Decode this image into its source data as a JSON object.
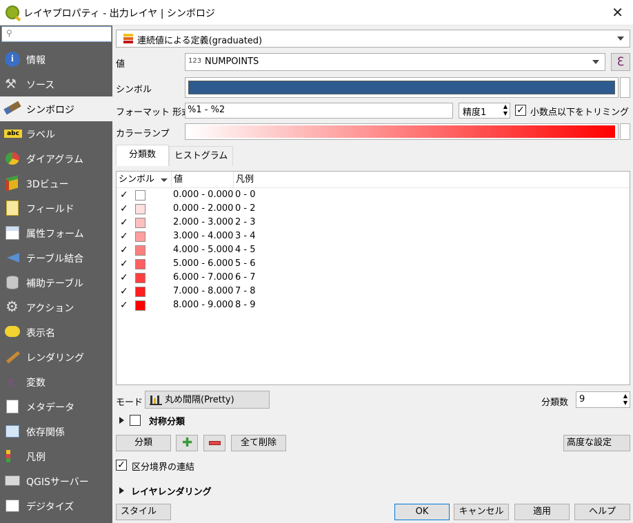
{
  "window": {
    "title": "レイヤプロパティ - 出力レイヤ | シンボロジ"
  },
  "sidebar": {
    "search_placeholder": "",
    "items": [
      {
        "label": "情報",
        "icon": "info-icon"
      },
      {
        "label": "ソース",
        "icon": "wrench-icon"
      },
      {
        "label": "シンボロジ",
        "icon": "paintbrush-icon"
      },
      {
        "label": "ラベル",
        "icon": "abc-label-icon"
      },
      {
        "label": "ダイアグラム",
        "icon": "diagram-icon"
      },
      {
        "label": "3Dビュー",
        "icon": "cube-icon"
      },
      {
        "label": "フィールド",
        "icon": "fields-icon"
      },
      {
        "label": "属性フォーム",
        "icon": "form-icon"
      },
      {
        "label": "テーブル結合",
        "icon": "join-icon"
      },
      {
        "label": "補助テーブル",
        "icon": "database-icon"
      },
      {
        "label": "アクション",
        "icon": "action-gear-icon"
      },
      {
        "label": "表示名",
        "icon": "speech-bubble-icon"
      },
      {
        "label": "レンダリング",
        "icon": "broom-icon"
      },
      {
        "label": "変数",
        "icon": "epsilon-icon"
      },
      {
        "label": "メタデータ",
        "icon": "metadata-icon"
      },
      {
        "label": "依存関係",
        "icon": "dependency-icon"
      },
      {
        "label": "凡例",
        "icon": "legend-icon"
      },
      {
        "label": "QGISサーバー",
        "icon": "server-icon"
      },
      {
        "label": "デジタイズ",
        "icon": "digitize-icon"
      }
    ]
  },
  "renderer": {
    "value": "連続値による定義(graduated)"
  },
  "value_field": {
    "label": "値",
    "type_badge": "123",
    "value": "NUMPOINTS"
  },
  "symbol": {
    "label": "シンボル",
    "color": "#2d5a8f"
  },
  "format": {
    "label": "フォーマット 形式",
    "value": "%1 - %2",
    "precision": "精度1",
    "trim_label": "小数点以下をトリミング"
  },
  "color_ramp": {
    "label": "カラーランプ",
    "start": "#ffffff",
    "end": "#ff0000"
  },
  "tabs": [
    {
      "label": "分類数"
    },
    {
      "label": "ヒストグラム"
    }
  ],
  "table": {
    "headers": [
      "シンボル",
      "値",
      "凡例"
    ],
    "rows": [
      {
        "value": "0.000 - 0.000",
        "legend": "0 - 0",
        "color": "#ffffff"
      },
      {
        "value": "0.000 - 2.000",
        "legend": "0 - 2",
        "color": "#ffdfdf"
      },
      {
        "value": "2.000 - 3.000",
        "legend": "2 - 3",
        "color": "#ffbfbf"
      },
      {
        "value": "3.000 - 4.000",
        "legend": "3 - 4",
        "color": "#ff9f9f"
      },
      {
        "value": "4.000 - 5.000",
        "legend": "4 - 5",
        "color": "#ff7f7f"
      },
      {
        "value": "5.000 - 6.000",
        "legend": "5 - 6",
        "color": "#ff5f5f"
      },
      {
        "value": "6.000 - 7.000",
        "legend": "6 - 7",
        "color": "#ff3f3f"
      },
      {
        "value": "7.000 - 8.000",
        "legend": "7 - 8",
        "color": "#ff1f1f"
      },
      {
        "value": "8.000 - 9.000",
        "legend": "8 - 9",
        "color": "#ff0000"
      }
    ]
  },
  "mode": {
    "label": "モード",
    "value": "丸め間隔(Pretty)"
  },
  "classes": {
    "label": "分類数",
    "value": "9"
  },
  "symmetric": {
    "label": "対称分類"
  },
  "buttons": {
    "classify": "分類",
    "delete_all": "全て削除",
    "advanced": "高度な設定",
    "style": "スタイル",
    "ok": "OK",
    "cancel": "キャンセル",
    "apply": "適用",
    "help": "ヘルプ"
  },
  "link_boundaries": {
    "label": "区分境界の連結"
  },
  "layer_rendering": {
    "label": "レイヤレンダリング"
  }
}
